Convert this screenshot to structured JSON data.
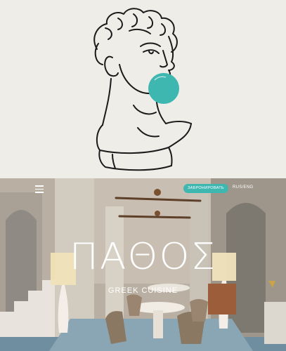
{
  "illustration": {
    "icon": "statue-bubblegum-icon",
    "bubble_color": "#3fb7b1",
    "line_color": "#1a1a1a"
  },
  "header": {
    "menu_icon": "hamburger-icon",
    "book_button_label": "ЗАБРОНИРОВАТЬ",
    "language_switch": "RUS/ENG"
  },
  "hero": {
    "title": "ΠΑΘΟΣ",
    "subtitle": "GREEK CUISINE"
  },
  "colors": {
    "background": "#efede8",
    "accent": "#3fb7b1",
    "text_on_photo": "#ffffff"
  }
}
